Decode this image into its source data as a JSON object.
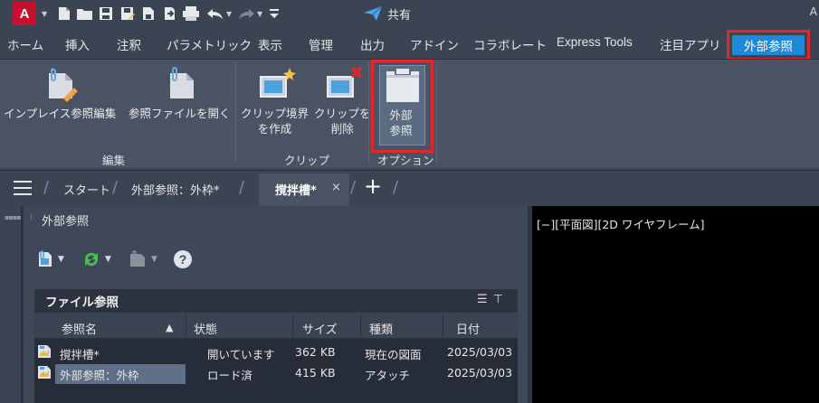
{
  "app": {
    "letter": "A",
    "share_label": "共有",
    "window_corner": "A"
  },
  "ribbon_tabs": [
    "ホーム",
    "挿入",
    "注釈",
    "パラメトリック",
    "表示",
    "管理",
    "出力",
    "アドイン",
    "コラボレート",
    "Express Tools",
    "注目アプリ"
  ],
  "active_tab": "外部参照",
  "ribbon": {
    "buttons": {
      "inplace_edit": "インプレイス参照編集",
      "open_ref": "参照ファイルを開く",
      "clip_create_1": "クリップ境界",
      "clip_create_2": "を作成",
      "clip_delete_1": "クリップを",
      "clip_delete_2": "削除",
      "xref_1": "外部",
      "xref_2": "参照"
    },
    "panels": {
      "edit": "編集",
      "clip": "クリップ",
      "options": "オプション"
    }
  },
  "file_tabs": {
    "start": "スタート",
    "tab1": "外部参照：外枠*",
    "tab2": "撹拌槽*",
    "close": "×",
    "new": "+"
  },
  "xref_palette": {
    "title": "外部参照",
    "section_title": "ファイル参照",
    "columns": [
      "参照名",
      "状態",
      "サイズ",
      "種類",
      "日付"
    ],
    "sort_arrow": "▲",
    "rows": [
      {
        "name": "撹拌槽*",
        "status": "開いています",
        "size": "362 KB",
        "type": "現在の図面",
        "date": "2025/03/03"
      },
      {
        "name": "外部参照：外枠",
        "status": "ロード済",
        "size": "415 KB",
        "type": "アタッチ",
        "date": "2025/03/03"
      }
    ]
  },
  "viewport": {
    "label": "[−][平面図][2D ワイヤフレーム]"
  },
  "colors": {
    "accent": "#1e88d9",
    "highlight": "#e2272a",
    "app_red": "#c8102e"
  }
}
